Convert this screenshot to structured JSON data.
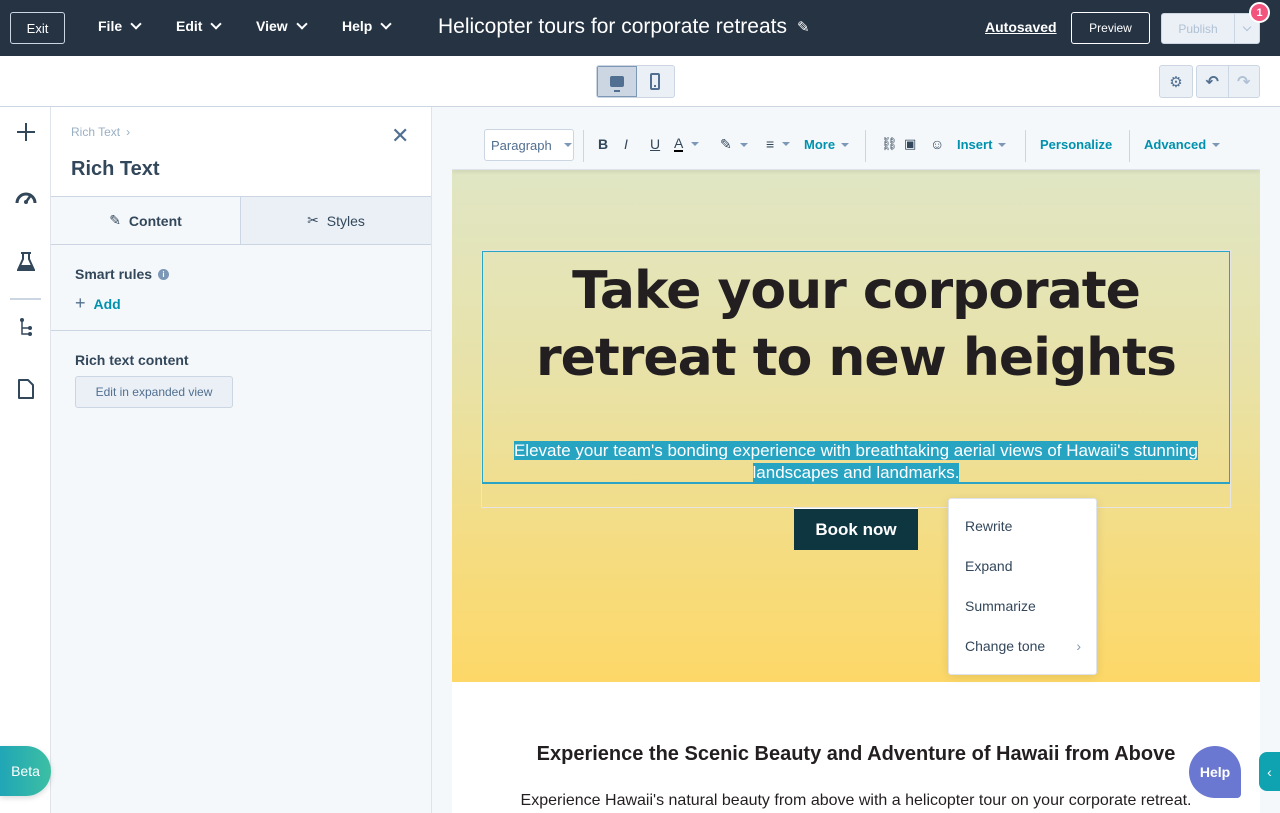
{
  "topbar": {
    "exit_label": "Exit",
    "menus": [
      "File",
      "Edit",
      "View",
      "Help"
    ],
    "page_title": "Helicopter tours for corporate retreats",
    "autosaved_label": "Autosaved",
    "preview_label": "Preview",
    "publish_label": "Publish",
    "notification_count": "1"
  },
  "subbar": {
    "device_selected": "desktop"
  },
  "rail": {
    "icons": [
      "plus-icon",
      "gauge-icon",
      "flask-icon",
      "tree-icon",
      "page-icon"
    ]
  },
  "panel": {
    "breadcrumb": "Rich Text",
    "title": "Rich Text",
    "tabs": [
      {
        "label": "Content",
        "active": true
      },
      {
        "label": "Styles",
        "active": false
      }
    ],
    "smart_rules_label": "Smart rules",
    "add_label": "Add",
    "rich_text_label": "Rich text content",
    "expand_button_label": "Edit in expanded view"
  },
  "beta_label": "Beta",
  "editor_toolbar": {
    "paragraph_select": "Paragraph",
    "bold": "B",
    "italic": "I",
    "underline": "U",
    "text_color": "A",
    "more_label": "More",
    "insert_label": "Insert",
    "personalize_label": "Personalize",
    "advanced_label": "Advanced"
  },
  "hero": {
    "title": "Take your corporate retreat to new heights",
    "subtitle": "Elevate your team's bonding experience with breathtaking aerial views of Hawaii's stunning landscapes and landmarks.",
    "cta_label": "Book now"
  },
  "ai_menu": {
    "items": [
      "Rewrite",
      "Expand",
      "Summarize",
      "Change tone"
    ]
  },
  "section": {
    "heading": "Experience the Scenic Beauty and Adventure of Hawaii from Above",
    "paragraph": "Experience Hawaii's natural beauty from above with a helicopter tour on your corporate retreat."
  },
  "help_label": "Help",
  "colors": {
    "topbar_bg": "#253342",
    "accent": "#0091ae",
    "selection": "#27a4c2",
    "cta_bg": "#0e3640",
    "badge": "#f2547d",
    "help_bg": "#6a78d1"
  }
}
